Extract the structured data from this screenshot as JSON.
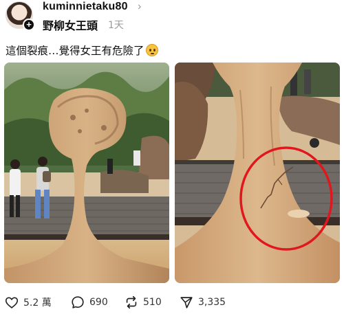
{
  "post": {
    "username": "kuminnietaku80",
    "topic": "野柳女王頭",
    "time_ago": "1天",
    "caption": "這個裂痕…覺得女王有危險了"
  },
  "icons": {
    "profile_chevron": "chevron-right-icon",
    "follow": "plus-icon",
    "caption_emoji": "pleading-face-emoji",
    "like": "heart-icon",
    "comment": "speech-bubble-icon",
    "repost": "repost-icon",
    "share": "send-icon"
  },
  "actions": {
    "likes": "5.2 萬",
    "comments": "690",
    "reposts": "510",
    "shares": "3,335"
  },
  "colors": {
    "highlight_circle": "#e0181d",
    "secondary_text": "#9a9a9a"
  }
}
